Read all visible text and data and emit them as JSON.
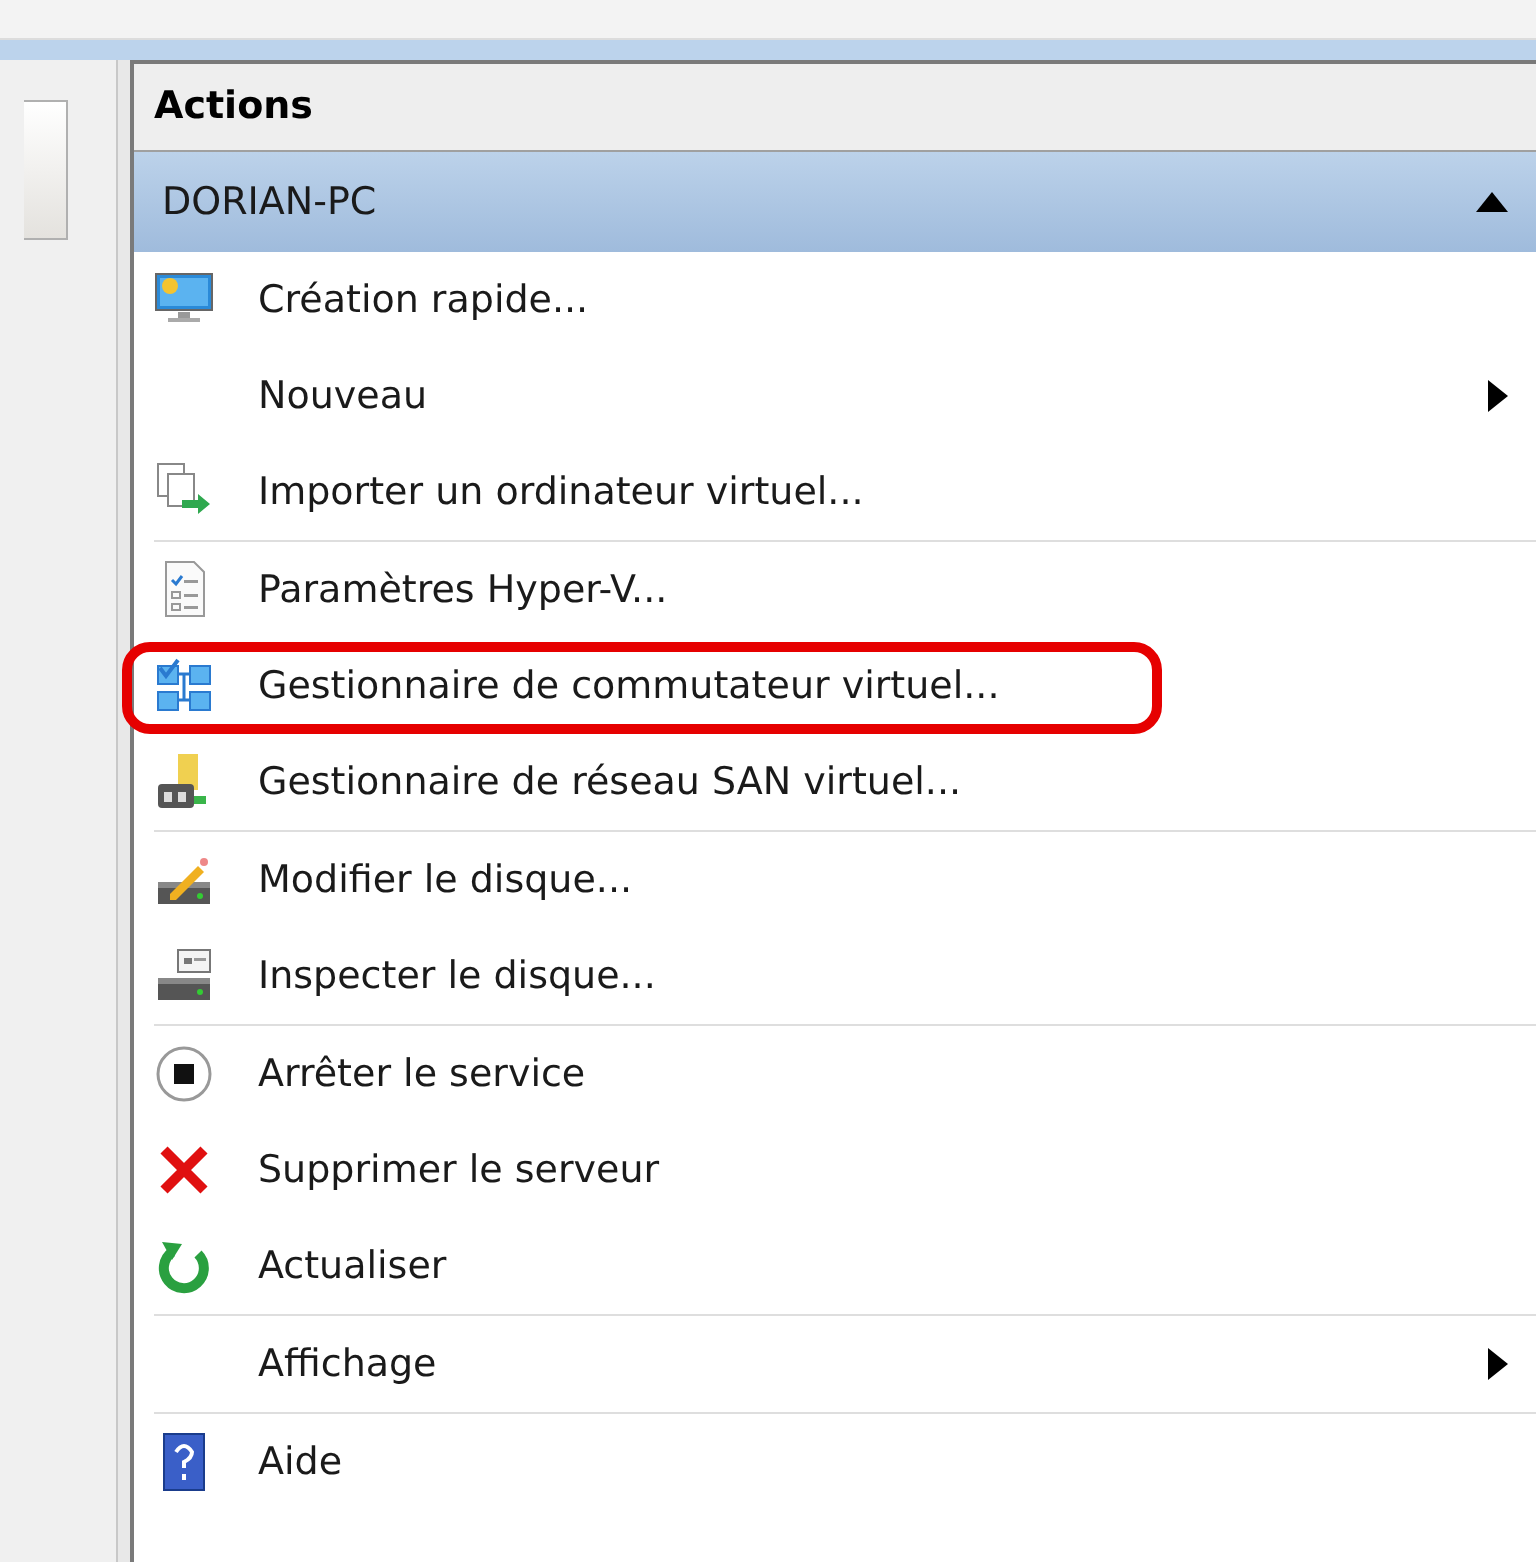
{
  "panel": {
    "title": "Actions"
  },
  "group": {
    "title": "DORIAN-PC",
    "expanded": true
  },
  "items": [
    {
      "label": "Création rapide...",
      "kind": "action",
      "separator_after": false,
      "highlighted": false
    },
    {
      "label": "Nouveau",
      "kind": "submenu",
      "separator_after": false,
      "highlighted": false
    },
    {
      "label": "Importer un ordinateur virtuel...",
      "kind": "action",
      "separator_after": true,
      "highlighted": false
    },
    {
      "label": "Paramètres Hyper-V...",
      "kind": "action",
      "separator_after": false,
      "highlighted": false
    },
    {
      "label": "Gestionnaire de commutateur virtuel...",
      "kind": "action",
      "separator_after": false,
      "highlighted": true
    },
    {
      "label": "Gestionnaire de réseau SAN virtuel...",
      "kind": "action",
      "separator_after": true,
      "highlighted": false
    },
    {
      "label": "Modifier le disque...",
      "kind": "action",
      "separator_after": false,
      "highlighted": false
    },
    {
      "label": "Inspecter le disque...",
      "kind": "action",
      "separator_after": true,
      "highlighted": false
    },
    {
      "label": "Arrêter le service",
      "kind": "action",
      "separator_after": false,
      "highlighted": false
    },
    {
      "label": "Supprimer le serveur",
      "kind": "action",
      "separator_after": false,
      "highlighted": false
    },
    {
      "label": "Actualiser",
      "kind": "action",
      "separator_after": true,
      "highlighted": false
    },
    {
      "label": "Affichage",
      "kind": "submenu",
      "separator_after": true,
      "highlighted": false
    },
    {
      "label": "Aide",
      "kind": "action",
      "separator_after": false,
      "highlighted": false
    }
  ]
}
